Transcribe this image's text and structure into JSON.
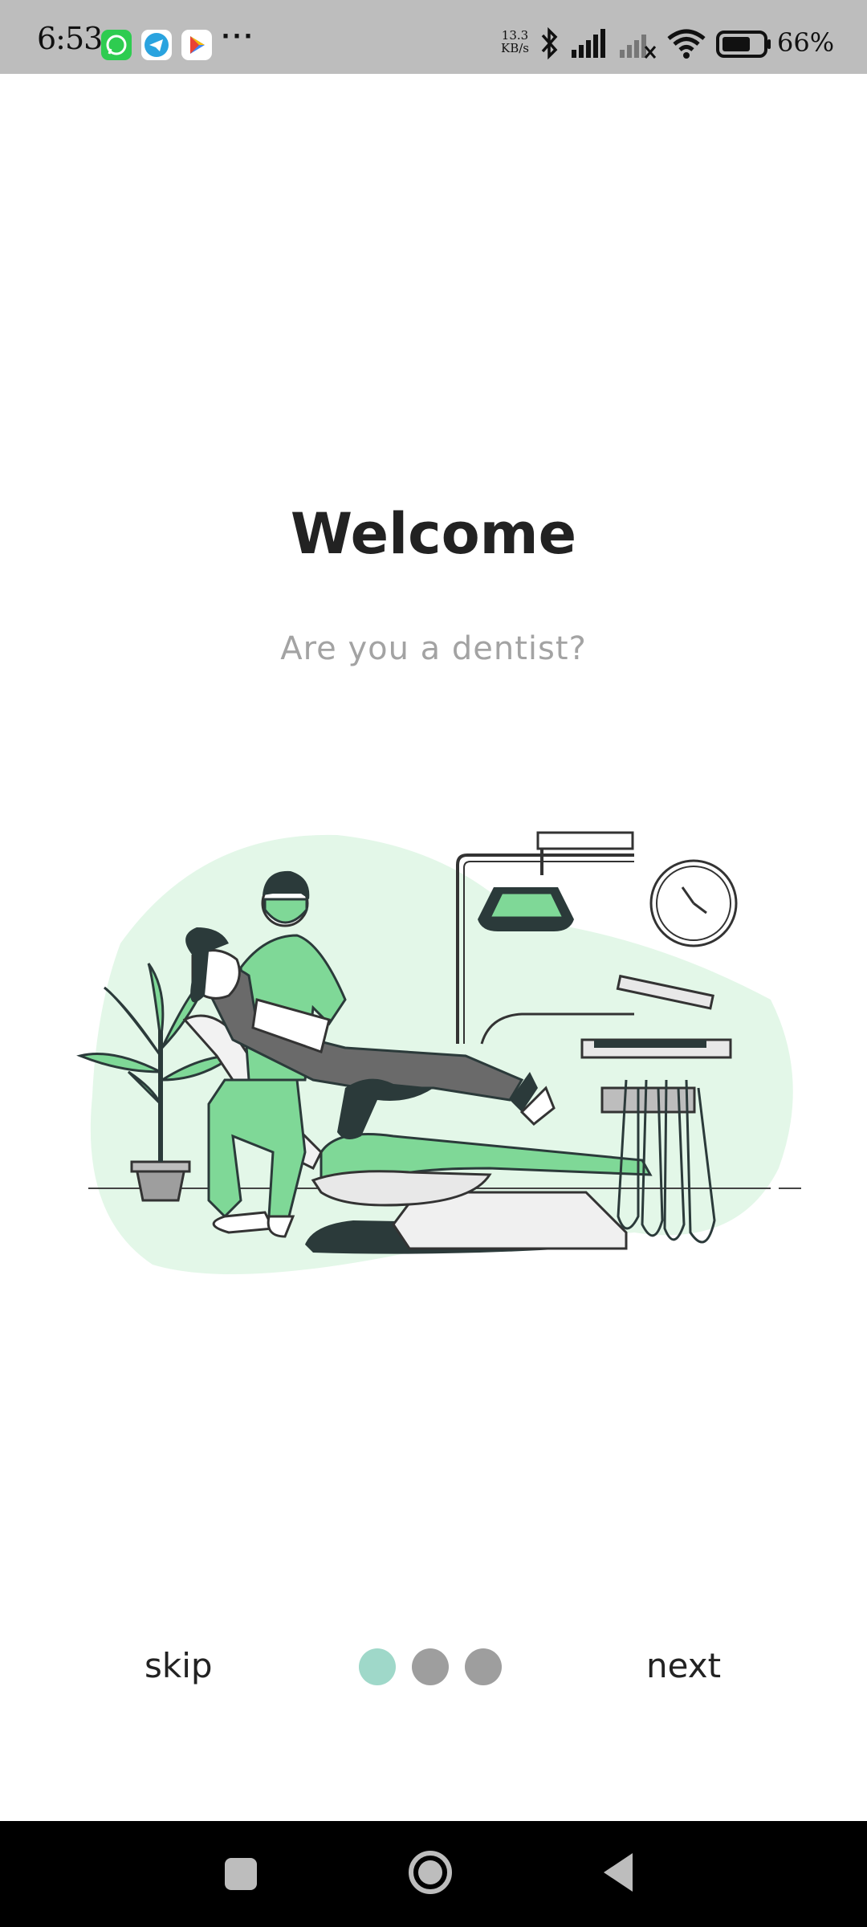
{
  "status_bar": {
    "time": "6:53",
    "net_speed_value": "13.3",
    "net_speed_unit": "KB/s",
    "battery_percent": "66%",
    "more": "···",
    "apps": [
      "whatsapp-icon",
      "telegram-icon",
      "play-store-icon"
    ]
  },
  "main": {
    "title": "Welcome",
    "subtitle": "Are you a dentist?",
    "illustration": "dentist-illustration"
  },
  "onboarding": {
    "skip_label": "skip",
    "next_label": "next",
    "page_count": 3,
    "current_page": 1
  },
  "colors": {
    "accent_dot": "#9fd8c9",
    "inactive_dot": "#9e9e9e",
    "illustration_green": "#7fd897",
    "illustration_bg": "#e3f7e8"
  },
  "nav_bar": [
    "recents-icon",
    "home-icon",
    "back-icon"
  ]
}
